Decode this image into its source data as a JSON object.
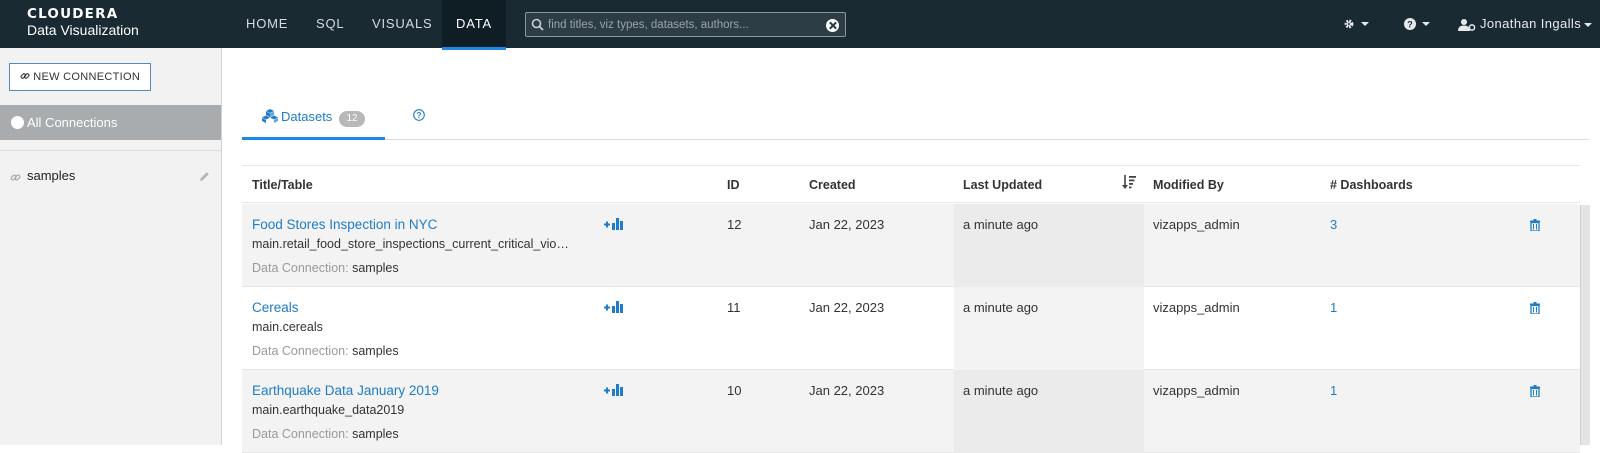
{
  "brand": {
    "name": "CLOUDERA",
    "product": "Data Visualization"
  },
  "nav": [
    {
      "label": "HOME"
    },
    {
      "label": "SQL"
    },
    {
      "label": "VISUALS"
    },
    {
      "label": "DATA",
      "active": true
    }
  ],
  "search": {
    "placeholder": "find titles, viz types, datasets, authors...",
    "value": ""
  },
  "header_icons": {
    "settings": "gear-icon",
    "help": "question-circle-icon"
  },
  "user": {
    "name": "Jonathan Ingalls"
  },
  "sidebar": {
    "new_connection_label": "NEW CONNECTION",
    "all_connections_label": "All Connections",
    "connections": [
      {
        "label": "samples"
      }
    ]
  },
  "tabs": {
    "datasets_label": "Datasets",
    "datasets_count": "12"
  },
  "table": {
    "headers": [
      "Title/Table",
      "ID",
      "Created",
      "Last Updated",
      "Modified By",
      "# Dashboards"
    ],
    "data_connection_label": "Data Connection:",
    "rows": [
      {
        "title": "Food Stores Inspection in NYC",
        "table": "main.retail_food_store_inspections_current_critical_vio…",
        "connection": "samples",
        "id": "12",
        "created": "Jan 22, 2023",
        "updated": "a minute ago",
        "modified_by": "vizapps_admin",
        "dashboards": "3"
      },
      {
        "title": "Cereals",
        "table": "main.cereals",
        "connection": "samples",
        "id": "11",
        "created": "Jan 22, 2023",
        "updated": "a minute ago",
        "modified_by": "vizapps_admin",
        "dashboards": "1"
      },
      {
        "title": "Earthquake Data January 2019",
        "table": "main.earthquake_data2019",
        "connection": "samples",
        "id": "10",
        "created": "Jan 22, 2023",
        "updated": "a minute ago",
        "modified_by": "vizapps_admin",
        "dashboards": "1"
      }
    ]
  },
  "colors": {
    "topbar": "#1a2a33",
    "accent": "#1e88e5",
    "link": "#1e7cc8"
  }
}
